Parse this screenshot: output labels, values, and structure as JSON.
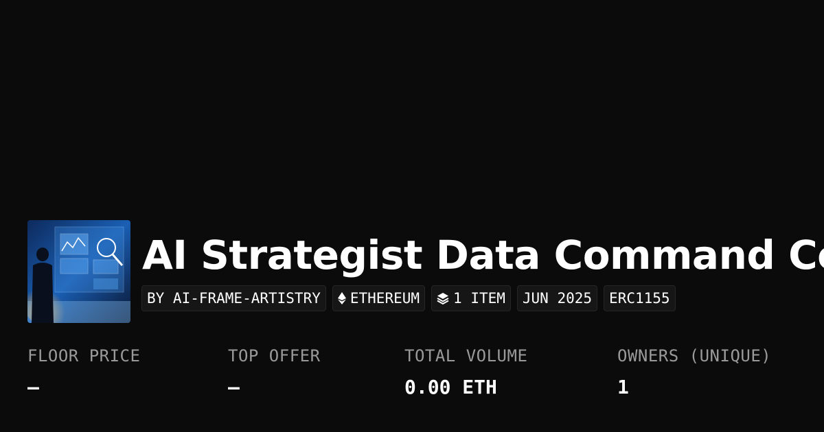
{
  "collection": {
    "title": "AI Strategist Data Command Cen",
    "thumbnail_icon": "collection-artwork-image"
  },
  "tags": {
    "creator": "BY AI-FRAME-ARTISTRY",
    "chain": "ETHEREUM",
    "chain_icon": "ethereum-icon",
    "items": "1 ITEM",
    "items_icon": "layers-icon",
    "date": "JUN 2025",
    "standard": "ERC1155"
  },
  "stats": [
    {
      "label": "FLOOR PRICE",
      "value": "–"
    },
    {
      "label": "TOP OFFER",
      "value": "–"
    },
    {
      "label": "TOTAL VOLUME",
      "value": "0.00 ETH"
    },
    {
      "label": "OWNERS (UNIQUE)",
      "value": "1"
    }
  ],
  "colors": {
    "background": "#0b0b0b",
    "tag_background": "#161616",
    "label": "#9a9a9a",
    "text": "#ffffff"
  }
}
